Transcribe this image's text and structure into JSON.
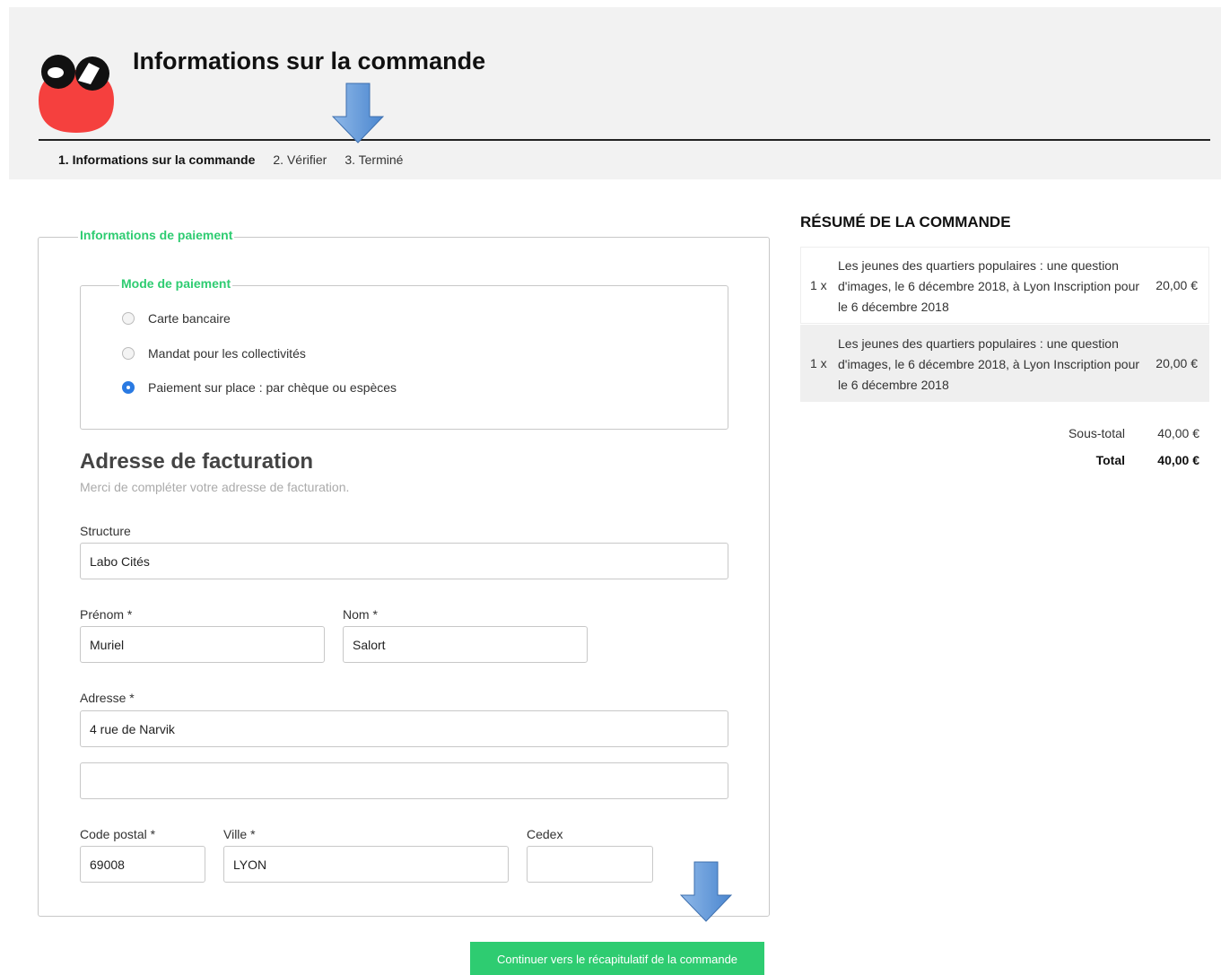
{
  "header": {
    "title": "Informations sur la commande",
    "steps": [
      "1. Informations sur la commande",
      "2. Vérifier",
      "3. Terminé"
    ]
  },
  "payment": {
    "legend": "Informations de paiement",
    "mode_legend": "Mode de paiement",
    "options": [
      {
        "label": "Carte bancaire",
        "checked": false
      },
      {
        "label": "Mandat pour les collectivités",
        "checked": false
      },
      {
        "label": "Paiement sur place : par chèque ou espèces",
        "checked": true
      }
    ]
  },
  "billing": {
    "title": "Adresse de facturation",
    "subtitle": "Merci de compléter votre adresse de facturation.",
    "structure": {
      "label": "Structure",
      "value": "Labo Cités"
    },
    "prenom": {
      "label": "Prénom *",
      "value": "Muriel"
    },
    "nom": {
      "label": "Nom *",
      "value": "Salort"
    },
    "adresse": {
      "label": "Adresse *",
      "value": "4 rue de Narvik",
      "value2": ""
    },
    "code_postal": {
      "label": "Code postal *",
      "value": "69008"
    },
    "ville": {
      "label": "Ville *",
      "value": "LYON"
    },
    "cedex": {
      "label": "Cedex",
      "value": ""
    }
  },
  "submit_label": "Continuer vers le récapitulatif de la commande",
  "summary": {
    "title": "RÉSUMÉ DE LA COMMANDE",
    "items": [
      {
        "qty": "1 x",
        "description": "Les jeunes des quartiers populaires : une question d'images, le 6 décembre 2018, à Lyon Inscription pour le 6 décembre 2018",
        "price": "20,00 €"
      },
      {
        "qty": "1 x",
        "description": "Les jeunes des quartiers populaires : une question d'images, le 6 décembre 2018, à Lyon Inscription pour le 6 décembre 2018",
        "price": "20,00 €"
      }
    ],
    "subtotal_label": "Sous-total",
    "subtotal": "40,00 €",
    "total_label": "Total",
    "total": "40,00 €"
  },
  "colors": {
    "accent": "#2ecc71",
    "logo_red": "#f5403e",
    "radio_blue": "#2a7ae2",
    "arrow_blue": "#5b9bd5"
  }
}
